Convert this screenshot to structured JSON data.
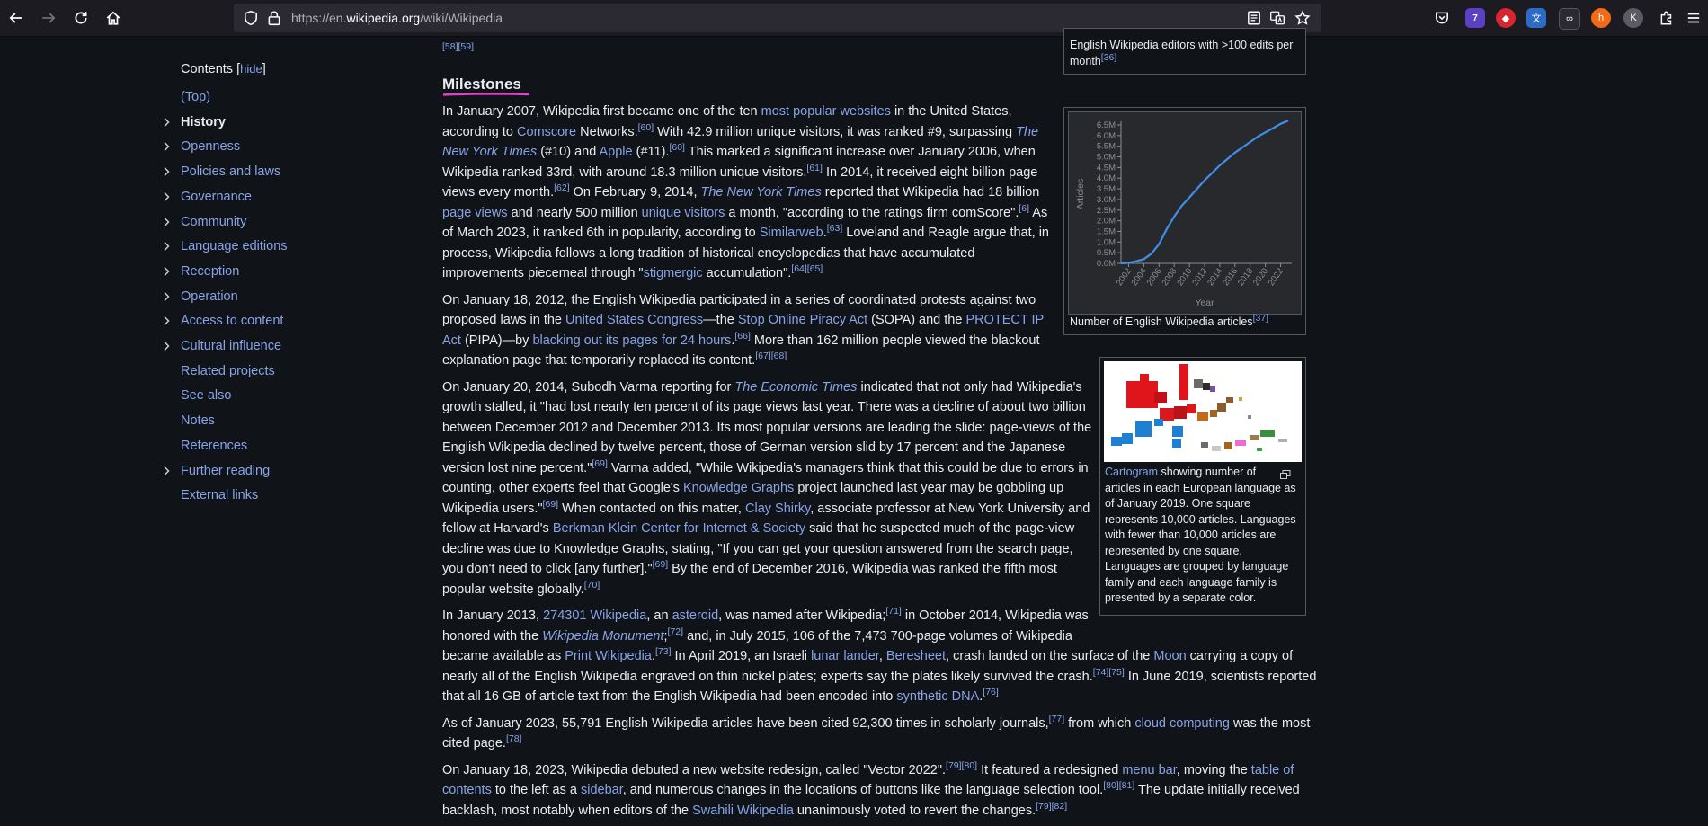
{
  "browser": {
    "url_prefix": "https://en.",
    "url_domain": "wikipedia.org",
    "url_path": "/wiki/Wikipedia",
    "icons": [
      "back-icon",
      "forward-icon",
      "reload-icon",
      "home-icon",
      "shield-icon",
      "lock-icon",
      "reader-view-icon",
      "translate-icon",
      "bookmark-star-icon",
      "pocket-icon",
      "extensions-icon"
    ],
    "ext_badge": "7",
    "profile_letter": "K"
  },
  "toc": {
    "title": "Contents",
    "hide_label": "hide",
    "items": [
      {
        "label": "(Top)",
        "expandable": false,
        "active": false
      },
      {
        "label": "History",
        "expandable": true,
        "active": true
      },
      {
        "label": "Openness",
        "expandable": true,
        "active": false
      },
      {
        "label": "Policies and laws",
        "expandable": true,
        "active": false
      },
      {
        "label": "Governance",
        "expandable": true,
        "active": false
      },
      {
        "label": "Community",
        "expandable": true,
        "active": false
      },
      {
        "label": "Language editions",
        "expandable": true,
        "active": false
      },
      {
        "label": "Reception",
        "expandable": true,
        "active": false
      },
      {
        "label": "Operation",
        "expandable": true,
        "active": false
      },
      {
        "label": "Access to content",
        "expandable": true,
        "active": false
      },
      {
        "label": "Cultural influence",
        "expandable": true,
        "active": false
      },
      {
        "label": "Related projects",
        "expandable": false,
        "active": false
      },
      {
        "label": "See also",
        "expandable": false,
        "active": false
      },
      {
        "label": "Notes",
        "expandable": false,
        "active": false
      },
      {
        "label": "References",
        "expandable": false,
        "active": false
      },
      {
        "label": "Further reading",
        "expandable": true,
        "active": false
      },
      {
        "label": "External links",
        "expandable": false,
        "active": false
      }
    ]
  },
  "article": {
    "top_refs": "[58][59]",
    "heading": "Milestones",
    "paragraphs": [
      [
        [
          [
            "t",
            "In January 2007, Wikipedia first became one of the ten "
          ],
          [
            "a",
            "most popular websites"
          ],
          [
            "t",
            " in the United States,"
          ]
        ],
        [
          [
            "t",
            "according to "
          ],
          [
            "a",
            "Comscore"
          ],
          [
            "t",
            " Networks."
          ],
          [
            "r",
            "[60]"
          ],
          [
            "t",
            " With 42.9 million unique visitors, it was ranked #9, surpassing "
          ],
          [
            "ai",
            "The"
          ]
        ],
        [
          [
            "ai",
            "New York Times"
          ],
          [
            "t",
            " (#10) and "
          ],
          [
            "a",
            "Apple"
          ],
          [
            "t",
            " (#11)."
          ],
          [
            "r",
            "[60]"
          ],
          [
            "t",
            " This marked a significant increase over January 2006, when"
          ]
        ],
        [
          [
            "t",
            "Wikipedia ranked 33rd, with around 18.3 million unique visitors."
          ],
          [
            "r",
            "[61]"
          ],
          [
            "t",
            " In 2014, it received eight billion page"
          ]
        ],
        [
          [
            "t",
            "views every month."
          ],
          [
            "r",
            "[62]"
          ],
          [
            "t",
            " On February 9, 2014, "
          ],
          [
            "ai",
            "The New York Times"
          ],
          [
            "t",
            " reported that Wikipedia had 18 billion"
          ]
        ],
        [
          [
            "a",
            "page views"
          ],
          [
            "t",
            " and nearly 500 million "
          ],
          [
            "a",
            "unique visitors"
          ],
          [
            "t",
            " a month, \"according to the ratings firm comScore\"."
          ],
          [
            "r",
            "[6]"
          ],
          [
            "t",
            " As"
          ]
        ],
        [
          [
            "t",
            "of March 2023, it ranked 6th in popularity, according to "
          ],
          [
            "a",
            "Similarweb"
          ],
          [
            "t",
            "."
          ],
          [
            "r",
            "[63]"
          ],
          [
            "t",
            " Loveland and Reagle argue that, in"
          ]
        ],
        [
          [
            "t",
            "process, Wikipedia follows a long tradition of historical encyclopedias that have accumulated"
          ]
        ],
        [
          [
            "t",
            "improvements piecemeal through \""
          ],
          [
            "a",
            "stigmergic"
          ],
          [
            "t",
            " accumulation\"."
          ],
          [
            "r",
            "[64][65]"
          ]
        ]
      ],
      [
        [
          [
            "t",
            "On January 18, 2012, the English Wikipedia participated in a series of coordinated protests against two"
          ]
        ],
        [
          [
            "t",
            "proposed laws in the "
          ],
          [
            "a",
            "United States Congress"
          ],
          [
            "t",
            "—the "
          ],
          [
            "a",
            "Stop Online Piracy Act"
          ],
          [
            "t",
            " (SOPA) and the "
          ],
          [
            "a",
            "PROTECT IP"
          ]
        ],
        [
          [
            "a",
            "Act"
          ],
          [
            "t",
            " (PIPA)—by "
          ],
          [
            "a",
            "blacking out its pages for 24 hours"
          ],
          [
            "t",
            "."
          ],
          [
            "r",
            "[66]"
          ],
          [
            "t",
            " More than 162 million people viewed the blackout"
          ]
        ],
        [
          [
            "t",
            "explanation page that temporarily replaced its content."
          ],
          [
            "r",
            "[67][68]"
          ]
        ]
      ],
      [
        [
          [
            "t",
            "On January 20, 2014, Subodh Varma reporting for "
          ],
          [
            "ai",
            "The Economic Times"
          ],
          [
            "t",
            " indicated that not only had Wikipedia's"
          ]
        ],
        [
          [
            "t",
            "growth stalled, it \"had lost nearly ten percent of its page views last year. There was a decline of about two billion"
          ]
        ],
        [
          [
            "t",
            "between December 2012 and December 2013. Its most popular versions are leading the slide: page-views of the"
          ]
        ],
        [
          [
            "t",
            "English Wikipedia declined by twelve percent, those of German version slid by 17 percent and the Japanese"
          ]
        ],
        [
          [
            "t",
            "version lost nine percent.\""
          ],
          [
            "r",
            "[69]"
          ],
          [
            "t",
            " Varma added, \"While Wikipedia's managers think that this could be due to errors in"
          ]
        ],
        [
          [
            "t",
            "counting, other experts feel that Google's "
          ],
          [
            "a",
            "Knowledge Graphs"
          ],
          [
            "t",
            " project launched last year may be gobbling up"
          ]
        ],
        [
          [
            "t",
            "Wikipedia users.\""
          ],
          [
            "r",
            "[69]"
          ],
          [
            "t",
            " When contacted on this matter, "
          ],
          [
            "a",
            "Clay Shirky"
          ],
          [
            "t",
            ", associate professor at New York University and"
          ]
        ],
        [
          [
            "t",
            "fellow at Harvard's "
          ],
          [
            "a",
            "Berkman Klein Center for Internet & Society"
          ],
          [
            "t",
            " said that he suspected much of the page-view"
          ]
        ],
        [
          [
            "t",
            "decline was due to Knowledge Graphs, stating, \"If you can get your question answered from the search page,"
          ]
        ],
        [
          [
            "t",
            "you don't need to click [any further].\""
          ],
          [
            "r",
            "[69]"
          ],
          [
            "t",
            " By the end of December 2016, Wikipedia was ranked the fifth most"
          ]
        ],
        [
          [
            "t",
            "popular website globally."
          ],
          [
            "r",
            "[70]"
          ]
        ]
      ],
      [
        [
          [
            "t",
            "In January 2013, "
          ],
          [
            "a",
            "274301 Wikipedia"
          ],
          [
            "t",
            ", an "
          ],
          [
            "a",
            "asteroid"
          ],
          [
            "t",
            ", was named after Wikipedia;"
          ],
          [
            "r",
            "[71]"
          ],
          [
            "t",
            " in October 2014, Wikipedia was"
          ]
        ],
        [
          [
            "t",
            "honored with the "
          ],
          [
            "ai",
            "Wikipedia Monument"
          ],
          [
            "t",
            ";"
          ],
          [
            "r",
            "[72]"
          ],
          [
            "t",
            " and, in July 2015, 106 of the 7,473 700-page volumes of Wikipedia"
          ]
        ],
        [
          [
            "t",
            "became available as "
          ],
          [
            "a",
            "Print Wikipedia"
          ],
          [
            "t",
            "."
          ],
          [
            "r",
            "[73]"
          ],
          [
            "t",
            " In April 2019, an Israeli "
          ],
          [
            "a",
            "lunar lander"
          ],
          [
            "t",
            ", "
          ],
          [
            "a",
            "Beresheet"
          ],
          [
            "t",
            ", crash landed on the surface of the "
          ],
          [
            "a",
            "Moon"
          ],
          [
            "t",
            " carrying a copy of"
          ]
        ],
        [
          [
            "t",
            "nearly all of the English Wikipedia engraved on thin nickel plates; experts say the plates likely survived the crash."
          ],
          [
            "r",
            "[74][75]"
          ],
          [
            "t",
            " In June 2019, scientists reported"
          ]
        ],
        [
          [
            "t",
            "that all 16 GB of article text from the English Wikipedia had been encoded into "
          ],
          [
            "a",
            "synthetic DNA"
          ],
          [
            "t",
            "."
          ],
          [
            "r",
            "[76]"
          ]
        ]
      ],
      [
        [
          [
            "t",
            "As of January 2023, 55,791 English Wikipedia articles have been cited 92,300 times in scholarly journals,"
          ],
          [
            "r",
            "[77]"
          ],
          [
            "t",
            " from which "
          ],
          [
            "a",
            "cloud computing"
          ],
          [
            "t",
            " was the most"
          ]
        ],
        [
          [
            "t",
            "cited page."
          ],
          [
            "r",
            "[78]"
          ]
        ]
      ],
      [
        [
          [
            "t",
            "On January 18, 2023, Wikipedia debuted a new website redesign, called \"Vector 2022\"."
          ],
          [
            "r",
            "[79][80]"
          ],
          [
            "t",
            " It featured a redesigned "
          ],
          [
            "a",
            "menu bar"
          ],
          [
            "t",
            ", moving the "
          ],
          [
            "a",
            "table of"
          ]
        ],
        [
          [
            "a",
            "contents"
          ],
          [
            "t",
            " to the left as a "
          ],
          [
            "a",
            "sidebar"
          ],
          [
            "t",
            ", and numerous changes in the locations of buttons like the language selection tool."
          ],
          [
            "r",
            "[80][81]"
          ],
          [
            "t",
            " The update initially received"
          ]
        ],
        [
          [
            "t",
            "backlash, most notably when editors of the "
          ],
          [
            "a",
            "Swahili Wikipedia"
          ],
          [
            "t",
            " unanimously voted to revert the changes."
          ],
          [
            "r",
            "[79][82]"
          ]
        ]
      ]
    ]
  },
  "fig_editors": {
    "caption_line1": "English Wikipedia editors with >100 edits per",
    "caption_line2": "month",
    "ref": "[36]"
  },
  "fig_articles": {
    "caption": "Number of English Wikipedia articles",
    "ref": "[37]"
  },
  "chart_data": {
    "type": "line",
    "title": "",
    "xlabel": "Year",
    "ylabel": "Articles",
    "x_ticks": [
      "2002",
      "2004",
      "2006",
      "2008",
      "2010",
      "2012",
      "2014",
      "2016",
      "2018",
      "2020",
      "2022"
    ],
    "y_ticks": [
      "0.0M",
      "0.5M",
      "1.0M",
      "1.5M",
      "2.0M",
      "2.5M",
      "3.0M",
      "3.5M",
      "4.0M",
      "4.5M",
      "5.0M",
      "5.5M",
      "6.0M",
      "6.5M"
    ],
    "xlim": [
      2001,
      2023
    ],
    "ylim": [
      0,
      6.5
    ],
    "series": [
      {
        "x": [
          2001,
          2002,
          2003,
          2004,
          2005,
          2006,
          2007,
          2008,
          2009,
          2010,
          2011,
          2012,
          2013,
          2014,
          2015,
          2016,
          2017,
          2018,
          2019,
          2020,
          2021,
          2022,
          2023
        ],
        "y": [
          0.0,
          0.02,
          0.1,
          0.2,
          0.45,
          0.9,
          1.6,
          2.2,
          2.7,
          3.1,
          3.5,
          3.9,
          4.25,
          4.6,
          4.9,
          5.2,
          5.45,
          5.7,
          5.95,
          6.15,
          6.35,
          6.55,
          6.7
        ]
      }
    ],
    "grid": false,
    "color": "#3f8fe8"
  },
  "fig_cartogram": {
    "caption_link": "Cartogram",
    "caption_lines": [
      " showing number of",
      "articles in each European language as",
      "of January 2019. One square",
      "represents 10,000 articles. Languages",
      "with fewer than 10,000 articles are",
      "represented by one square.",
      "Languages are grouped by language",
      "family and each language family is",
      "presented by a separate color."
    ],
    "enlarge_icon": "enlarge-icon"
  }
}
